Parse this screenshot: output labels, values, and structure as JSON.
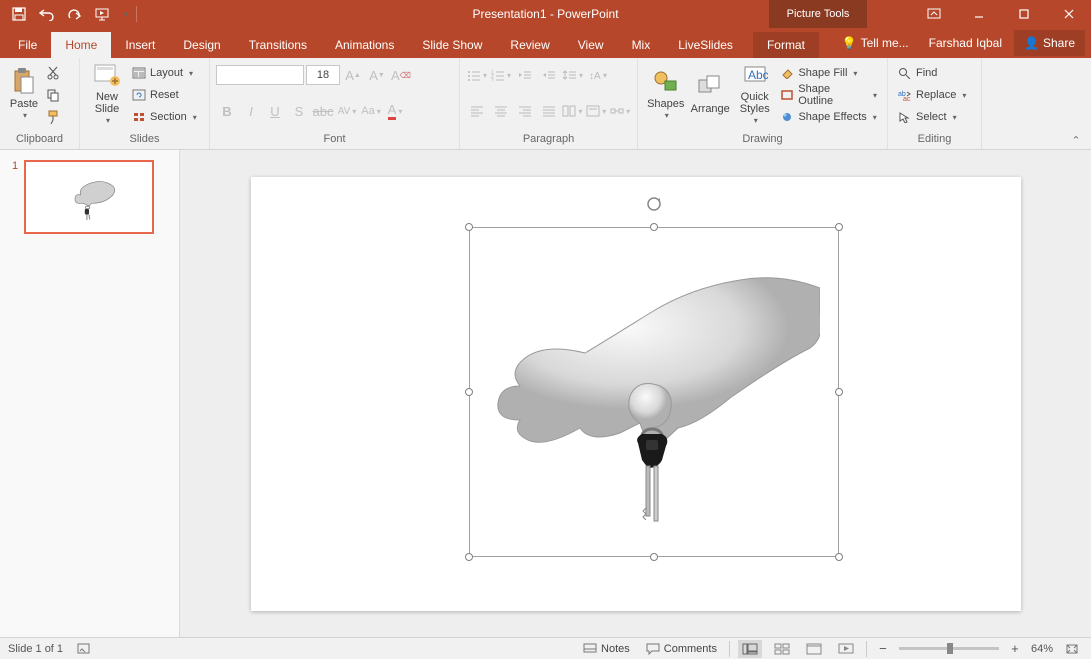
{
  "title": "Presentation1 - PowerPoint",
  "context_tools_label": "Picture Tools",
  "tabs": {
    "file": "File",
    "home": "Home",
    "insert": "Insert",
    "design": "Design",
    "transitions": "Transitions",
    "animations": "Animations",
    "slideshow": "Slide Show",
    "review": "Review",
    "view": "View",
    "mix": "Mix",
    "liveslides": "LiveSlides",
    "format": "Format"
  },
  "tabs_right": {
    "tellme": "Tell me...",
    "user": "Farshad Iqbal",
    "share": "Share"
  },
  "ribbon": {
    "clipboard": {
      "label": "Clipboard",
      "paste": "Paste"
    },
    "slides": {
      "label": "Slides",
      "new_slide": "New\nSlide",
      "layout": "Layout",
      "reset": "Reset",
      "section": "Section"
    },
    "font": {
      "label": "Font",
      "size": "18"
    },
    "paragraph": {
      "label": "Paragraph"
    },
    "drawing": {
      "label": "Drawing",
      "shapes": "Shapes",
      "arrange": "Arrange",
      "quick_styles": "Quick\nStyles",
      "fill": "Shape Fill",
      "outline": "Shape Outline",
      "effects": "Shape Effects"
    },
    "editing": {
      "label": "Editing",
      "find": "Find",
      "replace": "Replace",
      "select": "Select"
    }
  },
  "thumbnails": {
    "slide1_num": "1"
  },
  "statusbar": {
    "slide_info": "Slide 1 of 1",
    "notes": "Notes",
    "comments": "Comments",
    "zoom": "64%"
  }
}
